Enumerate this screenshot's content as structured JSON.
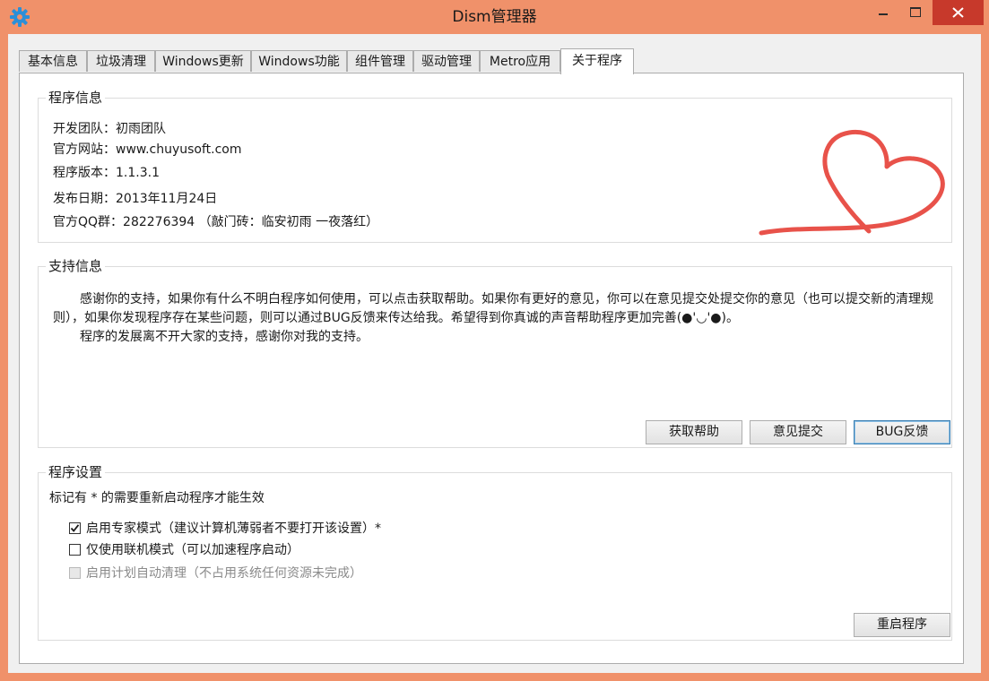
{
  "window": {
    "title": "Dism管理器",
    "icon": "gear-icon",
    "border_color": "#f0916a",
    "close_color": "#c7392b"
  },
  "tabs": [
    {
      "label": "基本信息"
    },
    {
      "label": "垃圾清理"
    },
    {
      "label": "Windows更新"
    },
    {
      "label": "Windows功能"
    },
    {
      "label": "组件管理"
    },
    {
      "label": "驱动管理"
    },
    {
      "label": "Metro应用"
    },
    {
      "label": "关于程序",
      "active": true
    }
  ],
  "program_info": {
    "title": "程序信息",
    "team": "开发团队：初雨团队",
    "website": "官方网站：www.chuyusoft.com",
    "version": "程序版本：1.1.3.1",
    "release_date": "发布日期：2013年11月24日",
    "qq_group": "官方QQ群：282276394 （敲门砖：临安初雨 一夜落红）",
    "logo_color": "#e8524a"
  },
  "support_info": {
    "title": "支持信息",
    "paragraph1": "感谢你的支持，如果你有什么不明白程序如何使用，可以点击获取帮助。如果你有更好的意见，你可以在意见提交处提交你的意见（也可以提交新的清理规则），如果你发现程序存在某些问题，则可以通过BUG反馈来传达给我。希望得到你真诚的声音帮助程序更加完善(●'◡'●)。",
    "paragraph2": "程序的发展离不开大家的支持，感谢你对我的支持。",
    "help_button": "获取帮助",
    "feedback_button": "意见提交",
    "bug_button": "BUG反馈"
  },
  "settings": {
    "title": "程序设置",
    "note": "标记有 * 的需要重新启动程序才能生效",
    "expert_mode": "启用专家模式（建议计算机薄弱者不要打开该设置）*",
    "online_mode": "仅使用联机模式（可以加速程序启动）",
    "auto_clean": "启用计划自动清理（不占用系统任何资源未完成）",
    "restart_button": "重启程序"
  }
}
